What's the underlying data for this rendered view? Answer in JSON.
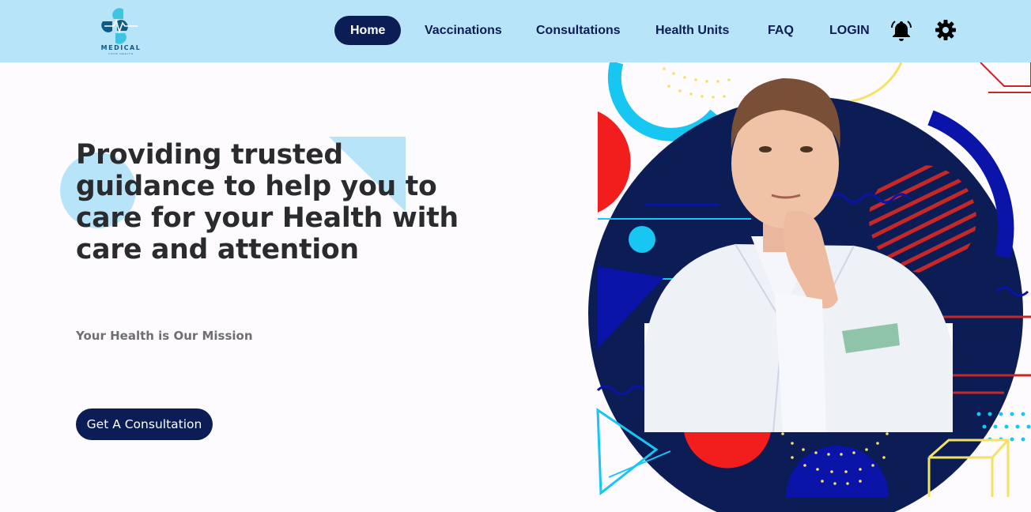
{
  "brand": {
    "logo_icon": "medical-cross-heartbeat-icon",
    "name": "MEDICAL",
    "tagline": "YOUR HEALTH"
  },
  "nav": {
    "items": [
      {
        "label": "Home",
        "active": true
      },
      {
        "label": "Vaccinations",
        "active": false
      },
      {
        "label": "Consultations",
        "active": false
      },
      {
        "label": "Health Units",
        "active": false
      },
      {
        "label": "FAQ",
        "active": false
      },
      {
        "label": "LOGIN",
        "active": false
      }
    ],
    "icons": [
      "bell-icon",
      "gear-icon"
    ]
  },
  "hero": {
    "title": "Providing trusted guidance to help you to care for your Health with care and attention",
    "subtitle": "Your Health is Our Mission",
    "cta_label": "Get A Consultation",
    "image_subject": "man in white suit thinking"
  },
  "colors": {
    "navbar_bg": "#b8e4fa",
    "primary_navy": "#0b1d54",
    "page_bg": "#fdfbfe",
    "accent_red": "#f21d1d",
    "accent_cyan": "#18c6f2",
    "accent_yellow": "#f3e264"
  }
}
